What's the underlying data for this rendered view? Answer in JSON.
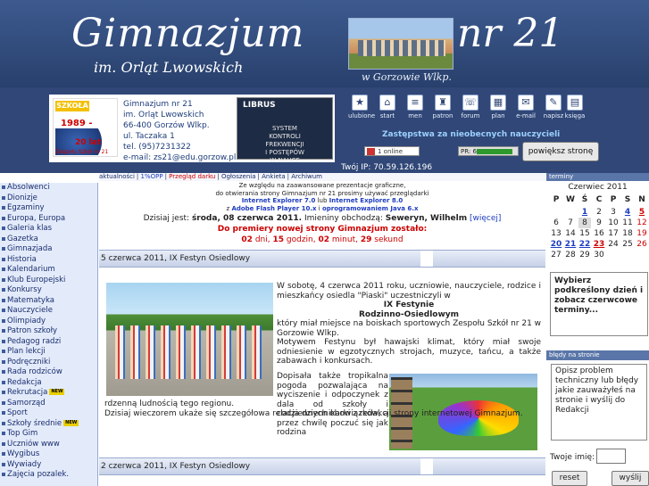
{
  "header": {
    "title_left": "Gimnazjum",
    "title_right": "nr 21",
    "subtitle": "im. Orląt Lwowskich",
    "city": "w Gorzowie Wlkp."
  },
  "logo": {
    "badge": "SZKOŁA",
    "years": "1989 - 2009",
    "anniv": "20 lat",
    "caption": "Zespołu Szkół nr 21"
  },
  "address": [
    "Gimnazjum nr 21",
    "im. Orląt Lwowskich",
    "66-400 Gorzów Wlkp.",
    "ul. Taczaka 1",
    "tel. (95)7231322",
    "e-mail: zs21@edu.gorzow.pl"
  ],
  "librus": {
    "name": "LIBRUS",
    "lines": [
      "SYSTEM",
      "KONTROLI",
      "FREKWENCJI",
      "I POSTĘPÓW",
      "W NAUCE"
    ]
  },
  "topnav": [
    {
      "label": "ulubione",
      "icon": "star-icon"
    },
    {
      "label": "start",
      "icon": "home-icon"
    },
    {
      "label": "men",
      "icon": "menu-icon"
    },
    {
      "label": "patron",
      "icon": "patron-icon"
    },
    {
      "label": "forum",
      "icon": "forum-icon"
    },
    {
      "label": "plan",
      "icon": "plan-icon"
    },
    {
      "label": "e-mail",
      "icon": "mail-icon"
    },
    {
      "label": "napisz",
      "icon": "pen-icon"
    },
    {
      "label": "księga",
      "icon": "book-icon"
    }
  ],
  "zastepstwa": "Zastępstwa za nieobecnych nauczycieli",
  "online": "1 online",
  "pagerank": "PR: 6",
  "enlarge_button": "powiększ stronę",
  "ip": "Twój IP: 70.59.126.196",
  "terminy_label": "terminy",
  "tabs": [
    "aktualności",
    "1%OPP",
    "Przegląd darku",
    "Ogłoszenia",
    "Ankieta",
    "Archiwum"
  ],
  "sidebar": [
    "Absolwenci",
    "Dionizje",
    "Egzaminy",
    "Europa, Europa",
    "Galeria klas",
    "Gazetka",
    "Gimnazjada",
    "Historia",
    "Kalendarium",
    "Klub Europejski",
    "Konkursy",
    "Matematyka",
    "Nauczyciele",
    "Olimpiady",
    "Patron szkoły",
    "Pedagog radzi",
    "Plan lekcji",
    "Podręczniki",
    "Rada rodziców",
    "Redakcja",
    "Rekrutacja",
    "Samorząd",
    "Sport",
    "Szkoły średnie",
    "Top Gim",
    "Uczniów www",
    "Wygibus",
    "Wywiady",
    "Zajęcia pozalek."
  ],
  "notice": {
    "line1": "Ze względu na zaawansowane prezentacje graficzne,",
    "line2": "do otwierania strony Gimnazjum nr 21 prosimy używać przeglądarki",
    "ie7": "Internet Explorer 7.0",
    "lub": "lub",
    "ie8": "Internet Explorer 8.0",
    "z": "z",
    "flash": "Adobe Flash Player 10.x",
    "i": "i",
    "java": "oprogramowaniem Java 6.x"
  },
  "date": {
    "label": "Dzisiaj jest:",
    "value": "środa, 08 czerwca 2011.",
    "names_label": "Imieniny obchodzą:",
    "names": "Seweryn, Wilhelm",
    "more": "[więcej]"
  },
  "premiere": "Do premiery nowej strony Gimnazjum zostało:",
  "countdown": {
    "d": "02",
    "dl": "dni,",
    "h": "15",
    "hl": "godzin,",
    "m": "02",
    "ml": "minut,",
    "s": "29",
    "sl": "sekund"
  },
  "article1": {
    "title": "5 czerwca 2011, IX Festyn Osiedlowy",
    "p1": "W sobotę, 4 czerwca 2011 roku, uczniowie, nauczyciele, rodzice i mieszkańcy osiedla \"Piaski\" uczestniczyli w",
    "c1": "IX Festynie",
    "c2": "Rodzinno-Osiedlowym",
    "p2": "który miał miejsce na boiskach sportowych Zespołu Szkół nr 21 w Gorzowie Wlkp.",
    "p3": "Motywem Festynu był hawajski klimat, który miał swoje odniesienie w egzotycznych strojach, muzyce, tańcu, a także zabawach i konkursach.",
    "p4": "Dopisała także tropikalna pogoda pozwalająca na wyciszenie i odpoczynek z dala od szkoły i codziennych obowiązków, a przez chwilę poczuć się jak rodzina",
    "p5": "rdzenną ludnością tego regionu.",
    "p6": "Dzisiaj wieczorem ukaże się szczegółowa relacja dziennikarki z redakcji strony internetowej Gimnazjum."
  },
  "article2": {
    "title": "2 czerwca 2011, IX Festyn Osiedlowy"
  },
  "calendar": {
    "title": "Czerwiec 2011",
    "days": [
      "P",
      "W",
      "Ś",
      "C",
      "P",
      "S",
      "N"
    ],
    "weeks": [
      [
        "",
        "",
        "1",
        "2",
        "3",
        "4",
        "5"
      ],
      [
        "6",
        "7",
        "8",
        "9",
        "10",
        "11",
        "12"
      ],
      [
        "13",
        "14",
        "15",
        "16",
        "17",
        "18",
        "19"
      ],
      [
        "20",
        "21",
        "22",
        "23",
        "24",
        "25",
        "26"
      ],
      [
        "27",
        "28",
        "29",
        "30",
        "",
        "",
        ""
      ]
    ]
  },
  "calendar_hint": "Wybierz podkreślony dzień i zobacz czerwcowe terminy...",
  "bledy_label": "błędy na stronie",
  "bledy_text": "Opisz problem techniczny lub błędy jakie zauważyłeś na stronie i wyślij do Redakcji",
  "name_label": "Twoje imię:",
  "reset_button": "reset",
  "send_button": "wyślij"
}
